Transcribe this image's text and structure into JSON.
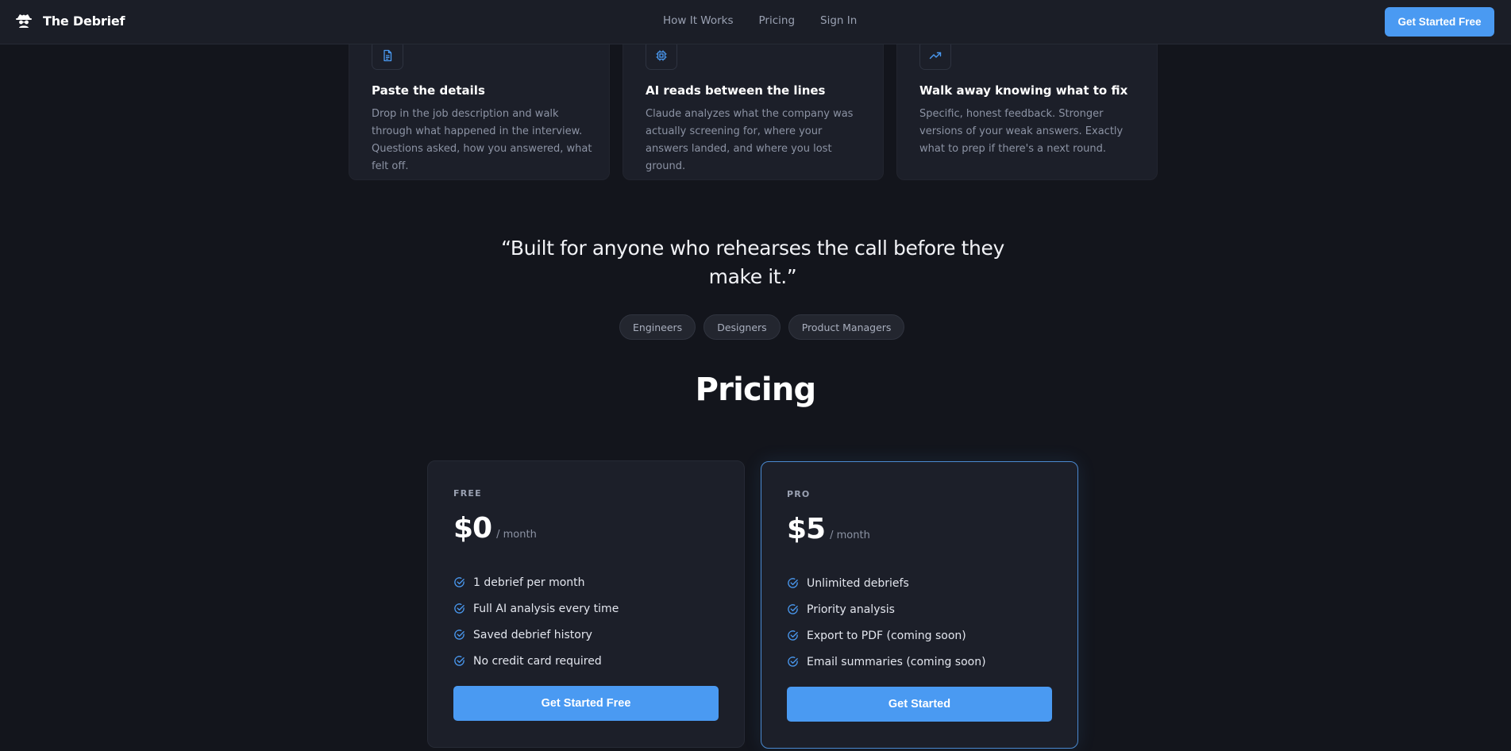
{
  "header": {
    "brand": "The Debrief",
    "brand_icon": "spy-icon",
    "nav": [
      "How It Works",
      "Pricing",
      "Sign In"
    ],
    "cta": "Get Started Free"
  },
  "features": [
    {
      "icon": "document-icon",
      "title": "Paste the details",
      "description": "Drop in the job description and walk through what happened in the interview. Questions asked, how you answered, what felt off."
    },
    {
      "icon": "cpu-chip-icon",
      "title": "AI reads between the lines",
      "description": "Claude analyzes what the company was actually screening for, where your answers landed, and where you lost ground."
    },
    {
      "icon": "trend-up-icon",
      "title": "Walk away knowing what to fix",
      "description": "Specific, honest feedback. Stronger versions of your weak answers. Exactly what to prep if there's a next round."
    }
  ],
  "quote": "“Built for anyone who rehearses the call before they make it.”",
  "audiences": [
    "Engineers",
    "Designers",
    "Product Managers"
  ],
  "pricing": {
    "heading": "Pricing",
    "plans": [
      {
        "name": "FREE",
        "price": "$0",
        "period": "/ month",
        "features": [
          "1 debrief per month",
          "Full AI analysis every time",
          "Saved debrief history",
          "No credit card required"
        ],
        "button": "Get Started Free"
      },
      {
        "name": "PRO",
        "price": "$5",
        "period": "/ month",
        "features": [
          "Unlimited debriefs",
          "Priority analysis",
          "Export to PDF (coming soon)",
          "Email summaries (coming soon)"
        ],
        "button": "Get Started"
      }
    ]
  },
  "colors": {
    "background": "#13151c",
    "card": "#1c1f29",
    "accent": "#4a9af2",
    "pro_border": "#4a89d0"
  }
}
